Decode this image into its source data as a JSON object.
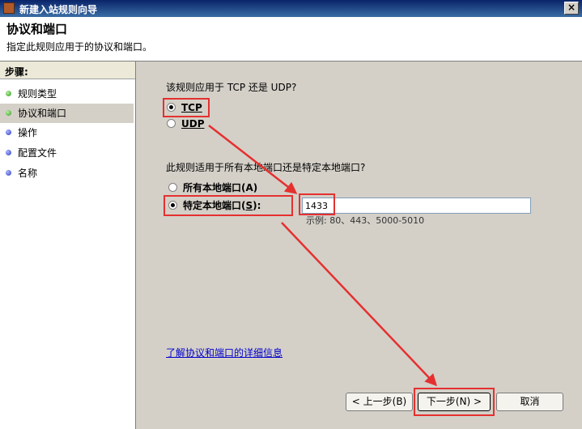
{
  "window": {
    "title": "新建入站规则向导",
    "close_glyph": "×"
  },
  "header": {
    "title": "协议和端口",
    "description": "指定此规则应用于的协议和端口。"
  },
  "steps": {
    "label": "步骤:",
    "items": [
      {
        "label": "规则类型",
        "status": "done"
      },
      {
        "label": "协议和端口",
        "status": "current"
      },
      {
        "label": "操作",
        "status": "pending"
      },
      {
        "label": "配置文件",
        "status": "pending"
      },
      {
        "label": "名称",
        "status": "pending"
      }
    ]
  },
  "protocol": {
    "question": "该规则应用于 TCP 还是 UDP?",
    "options": [
      {
        "text": "TCP",
        "mnemonic": "T",
        "checked": true
      },
      {
        "text": "UDP",
        "mnemonic": "U",
        "checked": false
      }
    ]
  },
  "ports": {
    "question": "此规则适用于所有本地端口还是特定本地端口?",
    "all_label": "所有本地端口",
    "all_mnemonic": "(A)",
    "specific_label": "特定本地端口",
    "specific_mnemonic_prefix": "(",
    "specific_mnemonic": "S",
    "specific_mnemonic_suffix": "):",
    "value": "1433",
    "example": "示例: 80、443、5000-5010"
  },
  "help_link": "了解协议和端口的详细信息",
  "buttons": {
    "back": "< 上一步(B)",
    "next": "下一步(N) >",
    "cancel": "取消"
  },
  "colors": {
    "annotation": "#e53030",
    "title_bar": "#0a246a",
    "link": "#0000cc"
  }
}
